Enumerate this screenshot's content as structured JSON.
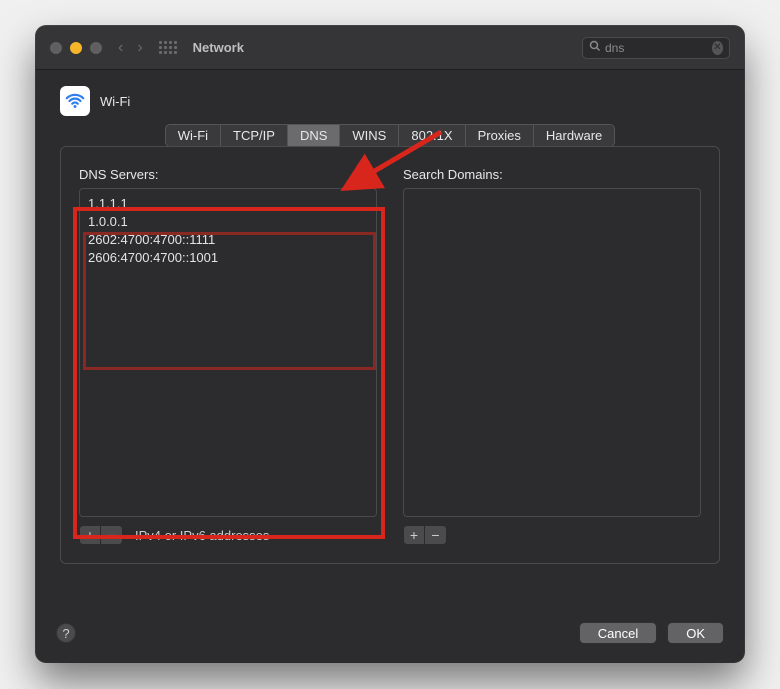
{
  "window": {
    "title": "Network"
  },
  "search": {
    "value": "dns"
  },
  "header": {
    "interface_name": "Wi-Fi"
  },
  "tabs": [
    {
      "label": "Wi-Fi"
    },
    {
      "label": "TCP/IP"
    },
    {
      "label": "DNS",
      "active": true
    },
    {
      "label": "WINS"
    },
    {
      "label": "802.1X"
    },
    {
      "label": "Proxies"
    },
    {
      "label": "Hardware"
    }
  ],
  "dns": {
    "servers_label": "DNS Servers:",
    "servers": [
      "1.1.1.1",
      "1.0.0.1",
      "2602:4700:4700::1111",
      "2606:4700:4700::1001"
    ],
    "hint": "IPv4 or IPv6 addresses",
    "domains_label": "Search Domains:",
    "domains": []
  },
  "buttons": {
    "add": "+",
    "remove": "−",
    "cancel": "Cancel",
    "ok": "OK",
    "help": "?"
  },
  "annotation": {
    "arrow_color": "#d8261c",
    "highlight_color": "#d8261c"
  }
}
